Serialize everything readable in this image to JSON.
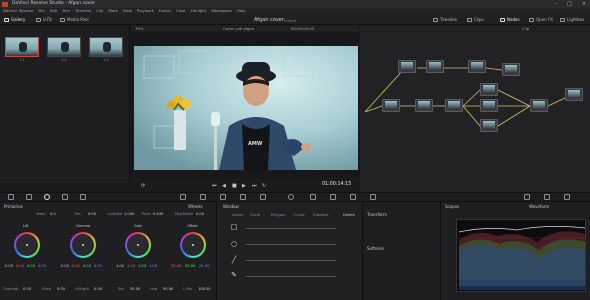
{
  "window": {
    "title": "DaVinci Resolve Studio - Afgan cover"
  },
  "menu": [
    "DaVinci Resolve",
    "File",
    "Edit",
    "Trim",
    "Timeline",
    "Clip",
    "Mark",
    "View",
    "Playback",
    "Fusion",
    "Color",
    "Fairlight",
    "Workspace",
    "Help"
  ],
  "toolbar": {
    "gallery": "Gallery",
    "luts": "LUTs",
    "media_pool": "Media Pool",
    "project_title": "Afgan cover",
    "edited": "Edited",
    "timeline": "Timeline",
    "clips": "Clips",
    "nodes": "Nodes",
    "open_fx": "Open FX",
    "lightbox": "Lightbox"
  },
  "gallery": {
    "thumbs": [
      {
        "label": "1.1"
      },
      {
        "label": "1.2"
      },
      {
        "label": "1.3"
      }
    ]
  },
  "viewer": {
    "zoom": "79%",
    "clip_name": "Cover yok afgan",
    "header_tc": "00:00:00:02",
    "timecode": "01:00:14:15"
  },
  "nodes": {
    "header": "Clip"
  },
  "primaries": {
    "title": "Primaries",
    "wheels_label": "Wheels",
    "top_params": [
      {
        "label": "Temp",
        "value": "0.0"
      },
      {
        "label": "Tint",
        "value": "0.00"
      },
      {
        "label": "Contrast",
        "value": "1.000"
      },
      {
        "label": "Pivot",
        "value": "0.435"
      },
      {
        "label": "Mid/Detail",
        "value": "0.00"
      }
    ],
    "wheels": [
      {
        "name": "Lift",
        "values": [
          "0.03",
          "0.03",
          "0.03",
          "0.03"
        ]
      },
      {
        "name": "Gamma",
        "values": [
          "0.02",
          "0.02",
          "0.02",
          "0.02"
        ]
      },
      {
        "name": "Gain",
        "values": [
          "1.00",
          "1.03",
          "1.03",
          "1.00"
        ]
      },
      {
        "name": "Offset",
        "values": [
          "25.00",
          "25.00",
          "25.00"
        ]
      }
    ],
    "bottom_params": [
      {
        "label": "Contrast",
        "value": "0.00"
      },
      {
        "label": "Shad",
        "value": "0.00"
      },
      {
        "label": "Hi/Light",
        "value": "0.00"
      },
      {
        "label": "Sat",
        "value": "50.00"
      },
      {
        "label": "Hue",
        "value": "50.00"
      },
      {
        "label": "L.Mix",
        "value": "100.00"
      }
    ]
  },
  "window_panel": {
    "title": "Window",
    "tabs": [
      "Linear",
      "Circle",
      "Polygon",
      "Curve",
      "Gradient"
    ],
    "delete": "Delete",
    "transform": "Transform",
    "softness": "Softness"
  },
  "scopes": {
    "title": "Scopes",
    "mode": "Waveform"
  },
  "colors": {
    "accent": "#d2443a",
    "panel": "#1f1f22"
  }
}
